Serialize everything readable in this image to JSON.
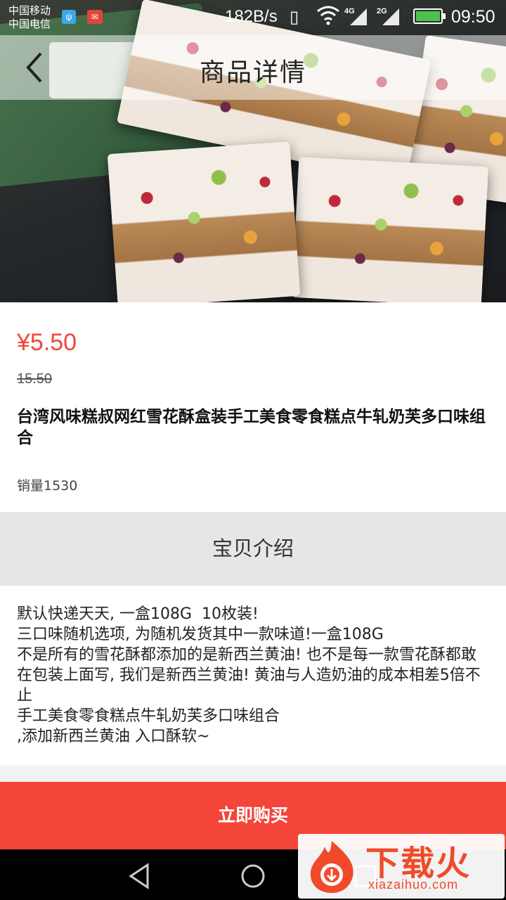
{
  "status_bar": {
    "carrier_1": "中国移动",
    "carrier_2": "中国电信",
    "net_speed": "182B/s",
    "net_4g": "4G",
    "net_2g": "2G",
    "time": "09:50",
    "battery_color": "#4cc24a"
  },
  "header": {
    "title": "商品详情",
    "back_icon": "chevron-left-icon"
  },
  "product": {
    "price": "¥5.50",
    "original_price": "15.50",
    "title": "台湾风味糕叔网红雪花酥盒装手工美食零食糕点牛轧奶芙多口味组合",
    "sales": "销量1530"
  },
  "section": {
    "label": "宝贝介绍"
  },
  "description": {
    "lines": [
      "默认快递天天, 一盒108G  10枚装!",
      "三口味随机选项, 为随机发货其中一款味道!一盒108G",
      "不是所有的雪花酥都添加的是新西兰黄油! 也不是每一款雪花酥都敢在包装上面写, 我们是新西兰黄油! 黄油与人造奶油的成本相差5倍不止",
      "手工美食零食糕点牛轧奶芙多口味组合",
      ",添加新西兰黄油 入口酥软~"
    ]
  },
  "actions": {
    "buy_label": "立即购买"
  },
  "colors": {
    "accent": "#f4453a",
    "section_bg": "#e6e6e6"
  },
  "watermark": {
    "brand": "下载火",
    "domain": "xiazaihuo.com"
  }
}
